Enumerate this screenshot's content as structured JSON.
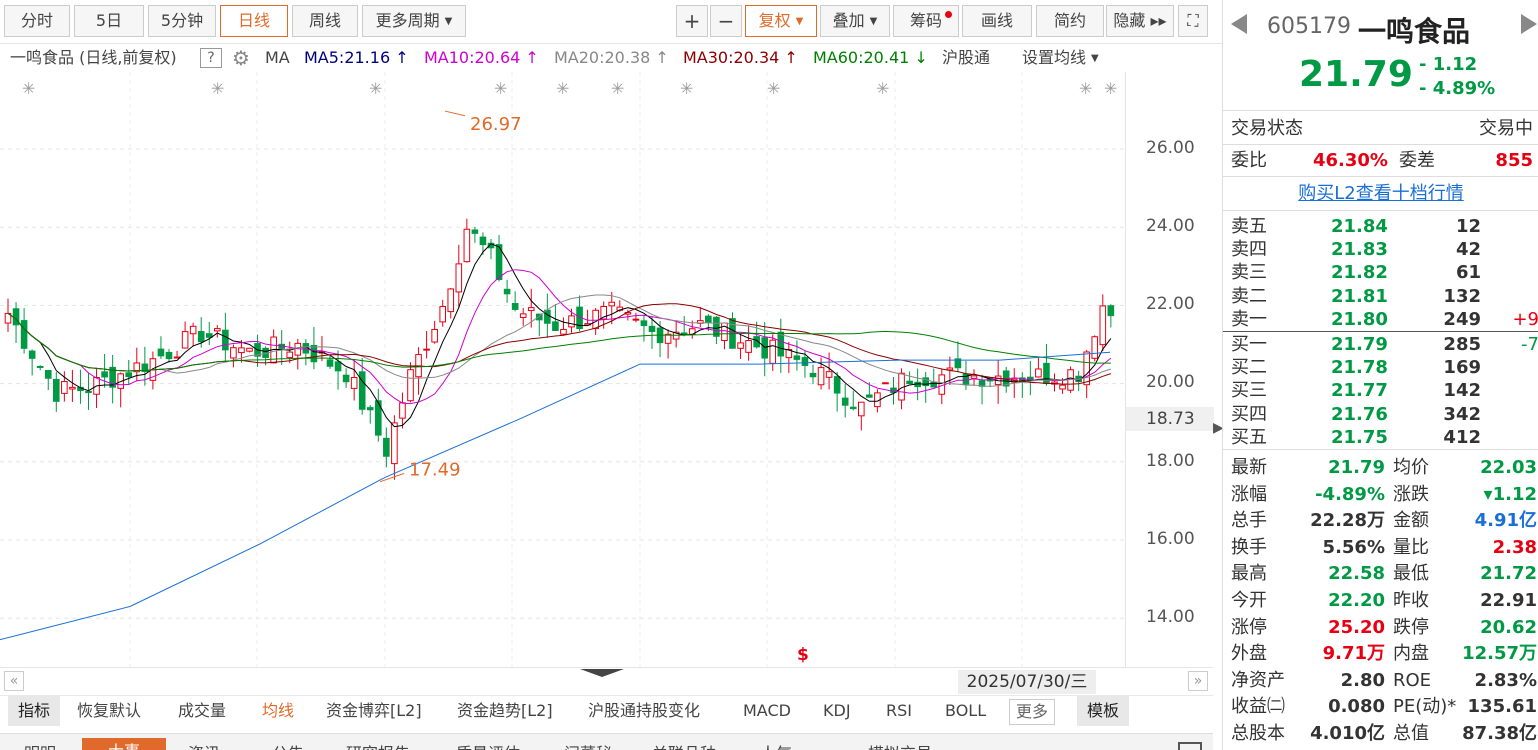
{
  "toolbar": {
    "items": [
      "分时",
      "5日",
      "5分钟",
      "日线",
      "周线",
      "更多周期",
      "+",
      "−",
      "复权",
      "叠加",
      "筹码",
      "画线",
      "简约",
      "隐藏 ▸▸"
    ],
    "active": "日线"
  },
  "legend": {
    "stock_label": "一鸣食品 (日线,前复权)",
    "help": "?",
    "ma_label": "MA",
    "ma5": "MA5:21.16",
    "ma10": "MA10:20.64",
    "ma20": "MA20:20.38",
    "ma30": "MA30:20.34",
    "ma60": "MA60:20.41",
    "hgt": "沪股通",
    "setting": "设置均线"
  },
  "chart_axis": {
    "ticks": [
      "26.00",
      "24.00",
      "22.00",
      "20.00",
      "18.00",
      "16.00",
      "14.00"
    ],
    "current_price": "18.73",
    "high_label": "26.97",
    "low_label": "17.49",
    "date": "2025/07/30/三",
    "marker": "$"
  },
  "indicators": [
    "指标",
    "恢复默认",
    "成交量",
    "均线",
    "资金博弈[L2]",
    "资金趋势[L2]",
    "沪股通持股变化",
    "MACD",
    "KDJ",
    "RSI",
    "BOLL",
    "更多",
    "模板"
  ],
  "bottom_tabs": [
    "明明",
    "大事",
    "资讯",
    "公告",
    "研究报告",
    "质量评估",
    "问董秘",
    "关联品种",
    "人气",
    "模拟交易"
  ],
  "panel": {
    "code": "605179",
    "name": "一鸣食品",
    "price": "21.79",
    "change": "- 1.12",
    "change_pct": "- 4.89%",
    "status_label": "交易状态",
    "status_value": "交易中",
    "wb_label": "委比",
    "wb_value": "46.30%",
    "wc_label": "委差",
    "wc_value": "855",
    "l2_link": "购买L2查看十档行情",
    "sell": [
      {
        "label": "卖五",
        "price": "21.84",
        "vol": "12",
        "chg": ""
      },
      {
        "label": "卖四",
        "price": "21.83",
        "vol": "42",
        "chg": ""
      },
      {
        "label": "卖三",
        "price": "21.82",
        "vol": "61",
        "chg": ""
      },
      {
        "label": "卖二",
        "price": "21.81",
        "vol": "132",
        "chg": ""
      },
      {
        "label": "卖一",
        "price": "21.80",
        "vol": "249",
        "chg": "+9"
      }
    ],
    "buy": [
      {
        "label": "买一",
        "price": "21.79",
        "vol": "285",
        "chg": "-7"
      },
      {
        "label": "买二",
        "price": "21.78",
        "vol": "169",
        "chg": ""
      },
      {
        "label": "买三",
        "price": "21.77",
        "vol": "142",
        "chg": ""
      },
      {
        "label": "买四",
        "price": "21.76",
        "vol": "342",
        "chg": ""
      },
      {
        "label": "买五",
        "price": "21.75",
        "vol": "412",
        "chg": ""
      }
    ],
    "stats": [
      {
        "l": "最新",
        "v": "21.79",
        "vc": "green",
        "l2": "均价",
        "v2": "22.03",
        "v2c": "green"
      },
      {
        "l": "涨幅",
        "v": "-4.89%",
        "vc": "green",
        "l2": "涨跌",
        "v2": "▾1.12",
        "v2c": "green"
      },
      {
        "l": "总手",
        "v": "22.28万",
        "vc": "",
        "l2": "金额",
        "v2": "4.91亿",
        "v2c": "blue"
      },
      {
        "l": "换手",
        "v": "5.56%",
        "vc": "",
        "l2": "量比",
        "v2": "2.38",
        "v2c": "red"
      },
      {
        "l": "最高",
        "v": "22.58",
        "vc": "green",
        "l2": "最低",
        "v2": "21.72",
        "v2c": "green"
      },
      {
        "l": "今开",
        "v": "22.20",
        "vc": "green",
        "l2": "昨收",
        "v2": "22.91",
        "v2c": ""
      },
      {
        "l": "涨停",
        "v": "25.20",
        "vc": "red",
        "l2": "跌停",
        "v2": "20.62",
        "v2c": "green"
      },
      {
        "l": "外盘",
        "v": "9.71万",
        "vc": "red",
        "l2": "内盘",
        "v2": "12.57万",
        "v2c": "green"
      },
      {
        "l": "净资产",
        "v": "2.80",
        "vc": "",
        "l2": "ROE",
        "v2": "2.83%",
        "v2c": ""
      },
      {
        "l": "收益㈡",
        "v": "0.080",
        "vc": "",
        "l2": "PE(动)*",
        "v2": "135.61",
        "v2c": ""
      },
      {
        "l": "总股本",
        "v": "4.010亿",
        "vc": "",
        "l2": "总值",
        "v2": "87.38亿",
        "v2c": ""
      }
    ]
  },
  "colors": {
    "up": "#e60012",
    "down": "#009944",
    "accent": "#e06a2b",
    "ma5": "#000000",
    "ma10": "#d000d0",
    "ma20": "#888888",
    "ma30": "#8b0000",
    "ma60": "#008000",
    "long": "#1a6fd6"
  }
}
